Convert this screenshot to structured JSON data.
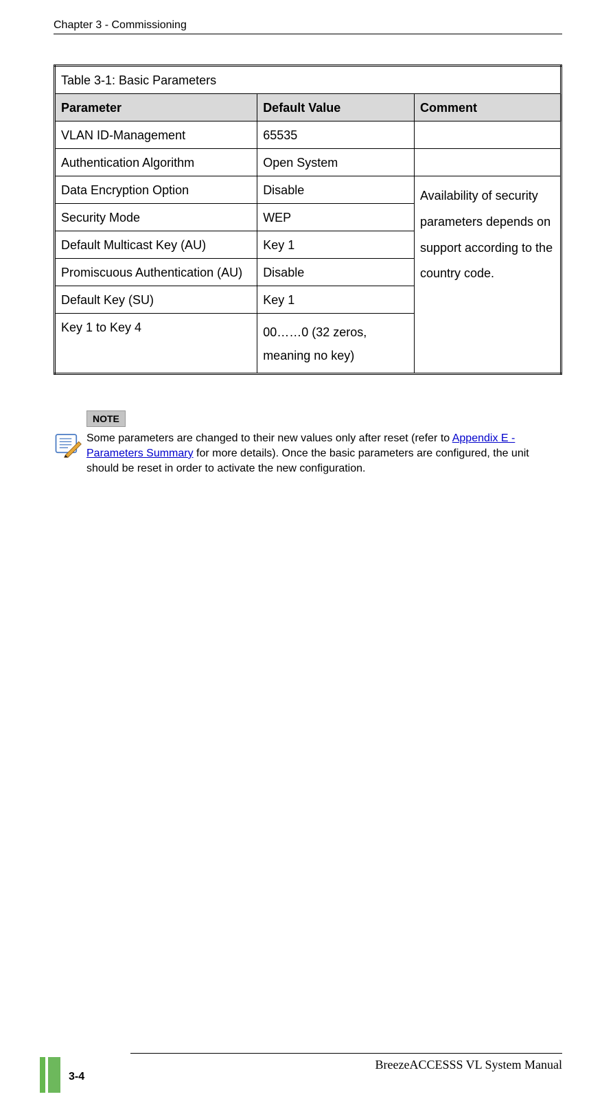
{
  "page_header": "Chapter 3 - Commissioning",
  "table": {
    "title": "Table 3-1: Basic Parameters",
    "headers": {
      "param": "Parameter",
      "default": "Default Value",
      "comment": "Comment"
    },
    "rows_top": [
      {
        "param": "VLAN ID-Management",
        "default": "65535",
        "comment": ""
      },
      {
        "param": "Authentication Algorithm",
        "default": "Open System",
        "comment": ""
      }
    ],
    "rows_span": [
      {
        "param": "Data Encryption Option",
        "default": "Disable"
      },
      {
        "param": "Security Mode",
        "default": "WEP"
      },
      {
        "param": "Default Multicast Key (AU)",
        "default": "Key 1"
      },
      {
        "param": "Promiscuous Authentication (AU)",
        "default": "Disable"
      },
      {
        "param": "Default Key (SU)",
        "default": "Key 1"
      },
      {
        "param": "Key 1 to Key 4",
        "default": "00……0 (32 zeros, meaning no key)"
      }
    ],
    "span_comment": "Availability of security parameters depends on support according to the country code."
  },
  "note": {
    "label": "NOTE",
    "icon_name": "note-pencil-icon",
    "text_pre": "Some parameters are changed to their new values only after reset (refer to ",
    "link1": "Appendix E - ",
    "link2": "Parameters Summary",
    "text_post": " for more details). Once the basic parameters are configured, the unit should be reset in order to activate the new configuration."
  },
  "footer": {
    "title": "BreezeACCESSS VL System Manual",
    "page": "3-4"
  }
}
